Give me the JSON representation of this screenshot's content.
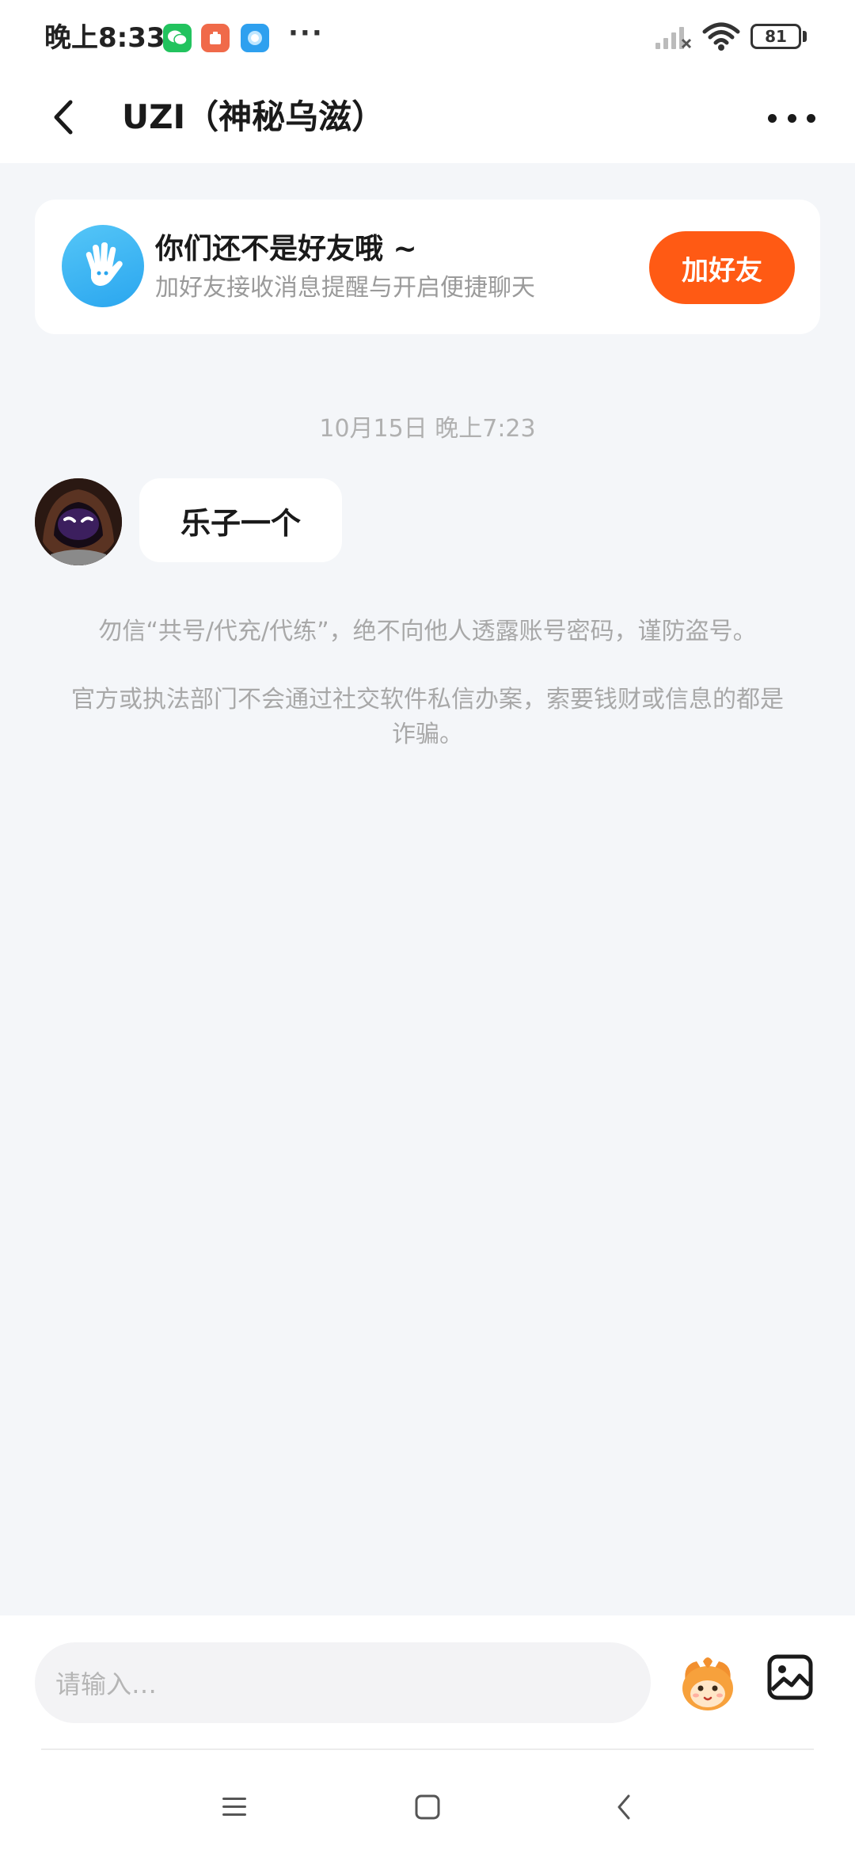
{
  "status_bar": {
    "time": "晚上8:33",
    "more_dots": "···",
    "battery_level": "81",
    "notification_icons": [
      "wechat-icon",
      "app-icon-orange",
      "app-icon-blue"
    ]
  },
  "header": {
    "title": "UZI（神秘乌滋）"
  },
  "friend_banner": {
    "title": "你们还不是好友哦 ~",
    "subtitle": "加好友接收消息提醒与开启便捷聊天",
    "button_label": "加好友"
  },
  "chat": {
    "timestamp": "10月15日 晚上7:23",
    "messages": [
      {
        "text": "乐子一个"
      }
    ]
  },
  "notices": {
    "line1": "勿信“共号/代充/代练”，绝不向他人透露账号密码，谨防盗号。",
    "line2": "官方或执法部门不会通过社交软件私信办案，索要钱财或信息的都是诈骗。"
  },
  "input": {
    "placeholder": "请输入…"
  },
  "colors": {
    "accent": "#ff5a14",
    "background": "#f4f6f9",
    "friend_icon": "#2aa6ef"
  }
}
